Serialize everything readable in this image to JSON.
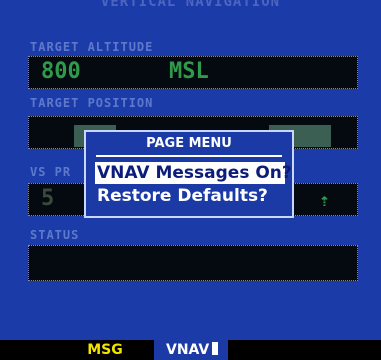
{
  "page": {
    "title": "VERTICAL NAVIGATION",
    "target_altitude_label": "TARGET ALTITUDE",
    "target_altitude_value": "800",
    "target_altitude_unit": "MSL",
    "target_position_label": "TARGET POSITION",
    "vs_profile_label": "VS PR",
    "vs_profile_value": "5",
    "status_label": "STATUS"
  },
  "menu": {
    "title": "PAGE MENU",
    "items": [
      {
        "label": "VNAV Messages On?",
        "selected": true
      },
      {
        "label": "Restore Defaults?",
        "selected": false
      }
    ]
  },
  "softkeys": {
    "msg": "MSG",
    "vnav": "VNAV"
  },
  "colors": {
    "screen_bg": "#1b3ba8",
    "field_bg": "#050a10",
    "softkey_msg": "#f2e400",
    "menu_highlight": "#ffffff"
  }
}
